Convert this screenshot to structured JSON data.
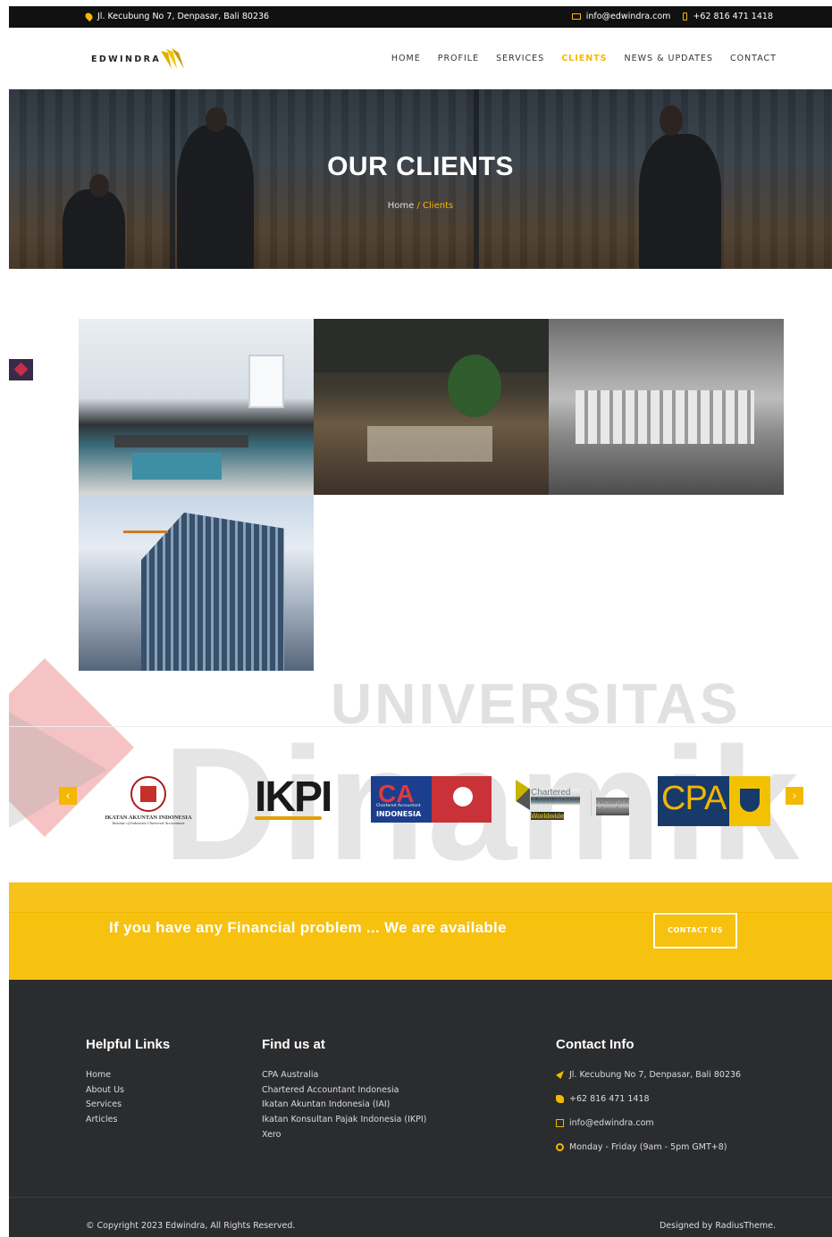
{
  "topbar": {
    "address": "Jl. Kecubung No 7, Denpasar, Bali 80236",
    "email": "info@edwindra.com",
    "phone": "+62 816 471 1418"
  },
  "header": {
    "logo_text": "EDWINDRA",
    "nav": [
      {
        "label": "HOME",
        "active": false
      },
      {
        "label": "PROFILE",
        "active": false
      },
      {
        "label": "SERVICES",
        "active": false
      },
      {
        "label": "CLIENTS",
        "active": true
      },
      {
        "label": "NEWS & UPDATES",
        "active": false
      },
      {
        "label": "CONTACT",
        "active": false
      }
    ]
  },
  "hero": {
    "title": "OUR CLIENTS",
    "breadcrumb_home": "Home",
    "breadcrumb_current": "/ Clients"
  },
  "watermark": {
    "line1": "UNIVERSITAS",
    "line2": "Dinamik"
  },
  "partners": {
    "prev_icon": "chevron-left-icon",
    "next_icon": "chevron-right-icon",
    "iai_text": "IKATAN AKUNTAN INDONESIA",
    "iai_sub": "Institute of Indonesia Chartered Accountants",
    "ikpi_text": "IKPI",
    "ca_big": "CA",
    "ca_sub": "Chartered Accountant",
    "ca_country": "INDONESIA",
    "caw_line1": "Chartered",
    "caw_line2": "Accountants",
    "caw_line3": "Worldwide",
    "caw_network1": "Network",
    "caw_network2": "Member",
    "cpa_text": "CPA"
  },
  "cta": {
    "message": "If you have any Financial problem ... We are available",
    "button": "CONTACT US"
  },
  "footer": {
    "helpful_title": "Helpful Links",
    "helpful_links": [
      "Home",
      "About Us",
      "Services",
      "Articles"
    ],
    "find_title": "Find us at",
    "find_links": [
      "CPA Australia",
      "Chartered Accountant Indonesia",
      "Ikatan Akuntan Indonesia (IAI)",
      "Ikatan Konsultan Pajak Indonesia (IKPI)",
      "Xero"
    ],
    "contact_title": "Contact Info",
    "contact_address": "Jl. Kecubung No 7, Denpasar, Bali 80236",
    "contact_phone": "+62 816 471 1418",
    "contact_email": "info@edwindra.com",
    "contact_hours": "Monday - Friday (9am - 5pm GMT+8)",
    "copyright": "© Copyright 2023 Edwindra, All Rights Reserved.",
    "designed_by": "Designed by RadiusTheme."
  },
  "colors": {
    "accent": "#f5b800",
    "footer_bg": "#2b2c2e",
    "topbar_bg": "#111111"
  }
}
